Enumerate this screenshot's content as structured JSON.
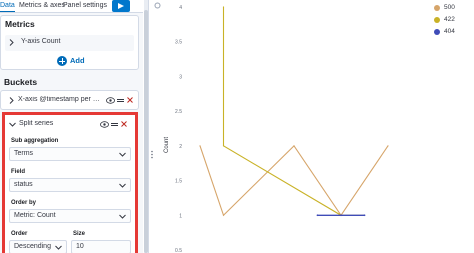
{
  "tabs": [
    {
      "label": "Data"
    },
    {
      "label": "Metrics & axes"
    },
    {
      "label": "Panel settings"
    }
  ],
  "metrics": {
    "title": "Metrics",
    "items": [
      {
        "label": "Y-axis Count"
      }
    ],
    "add_label": "Add"
  },
  "buckets": {
    "title": "Buckets",
    "items": [
      {
        "label": "X-axis @timestamp per mi..."
      }
    ]
  },
  "split_series": {
    "title": "Split series",
    "sub_aggregation": {
      "label": "Sub aggregation",
      "value": "Terms"
    },
    "field": {
      "label": "Field",
      "value": "status"
    },
    "order_by": {
      "label": "Order by",
      "value": "Metric: Count"
    },
    "order": {
      "label": "Order",
      "value": "Descending"
    },
    "size": {
      "label": "Size",
      "value": "10"
    }
  },
  "icons": {
    "run": "play-icon",
    "expand": "chevron-right-icon",
    "collapse": "chevron-down-icon",
    "visibility": "eye-icon",
    "drag": "drag-handle-icon",
    "remove": "close-icon",
    "add": "plus-circle-icon",
    "dropdown": "chevron-down-icon"
  },
  "colors": {
    "accent": "#006bb8",
    "highlight_border": "#e53935",
    "series_500": "#d6a56a",
    "series_422": "#c9b227",
    "series_404": "#3f4cb8"
  },
  "chart_data": {
    "type": "line",
    "ylabel": "Count",
    "ylim": [
      0.5,
      4
    ],
    "y_ticks": [
      "4",
      "3.5",
      "3",
      "2.5",
      "2",
      "1.5",
      "1",
      "0.5"
    ],
    "x_index": [
      0,
      1,
      2,
      3,
      4,
      5,
      6,
      7,
      8
    ],
    "series": [
      {
        "name": "500",
        "color": "#d6a56a",
        "points": [
          [
            0,
            2
          ],
          [
            1,
            1
          ],
          [
            4,
            2
          ],
          [
            6,
            1
          ],
          [
            8,
            2
          ]
        ]
      },
      {
        "name": "422",
        "color": "#c9b227",
        "points": [
          [
            1,
            4
          ],
          [
            1,
            2
          ],
          [
            6,
            1
          ],
          [
            7,
            1
          ]
        ]
      },
      {
        "name": "404",
        "color": "#3f4cb8",
        "points": [
          [
            5,
            1
          ],
          [
            6,
            1
          ],
          [
            7,
            1
          ]
        ]
      }
    ],
    "legend_position": "top-right",
    "legend": [
      "500",
      "422",
      "404"
    ]
  }
}
